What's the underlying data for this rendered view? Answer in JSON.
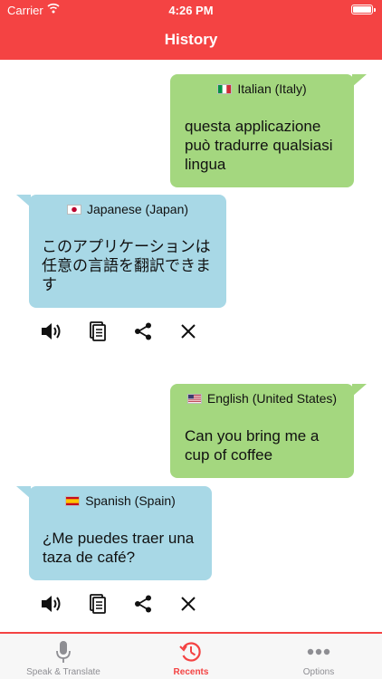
{
  "status_bar": {
    "carrier": "Carrier",
    "time": "4:26 PM"
  },
  "header": {
    "title": "History"
  },
  "entries": [
    {
      "source": {
        "language": "Italian (Italy)",
        "flag": "italy-flag",
        "text": "questa applicazione può tradurre qualsiasi lingua"
      },
      "target": {
        "language": "Japanese (Japan)",
        "flag": "japan-flag",
        "text": "このアプリケーションは任意の言語を翻訳できます"
      }
    },
    {
      "source": {
        "language": "English (United States)",
        "flag": "us-flag",
        "text": "Can you bring me a cup of coffee"
      },
      "target": {
        "language": "Spanish (Spain)",
        "flag": "spain-flag",
        "text": "¿Me puedes traer una taza de café?"
      }
    }
  ],
  "actions": [
    "speaker-icon",
    "copy-icon",
    "share-icon",
    "close-icon"
  ],
  "tabs": [
    {
      "label": "Speak & Translate",
      "icon": "microphone-icon",
      "active": false
    },
    {
      "label": "Recents",
      "icon": "history-icon",
      "active": true
    },
    {
      "label": "Options",
      "icon": "more-icon",
      "active": false
    }
  ],
  "colors": {
    "accent": "#f44343",
    "source_bubble": "#a4d77f",
    "target_bubble": "#a8d8e6",
    "inactive_tab": "#8e8e93"
  }
}
